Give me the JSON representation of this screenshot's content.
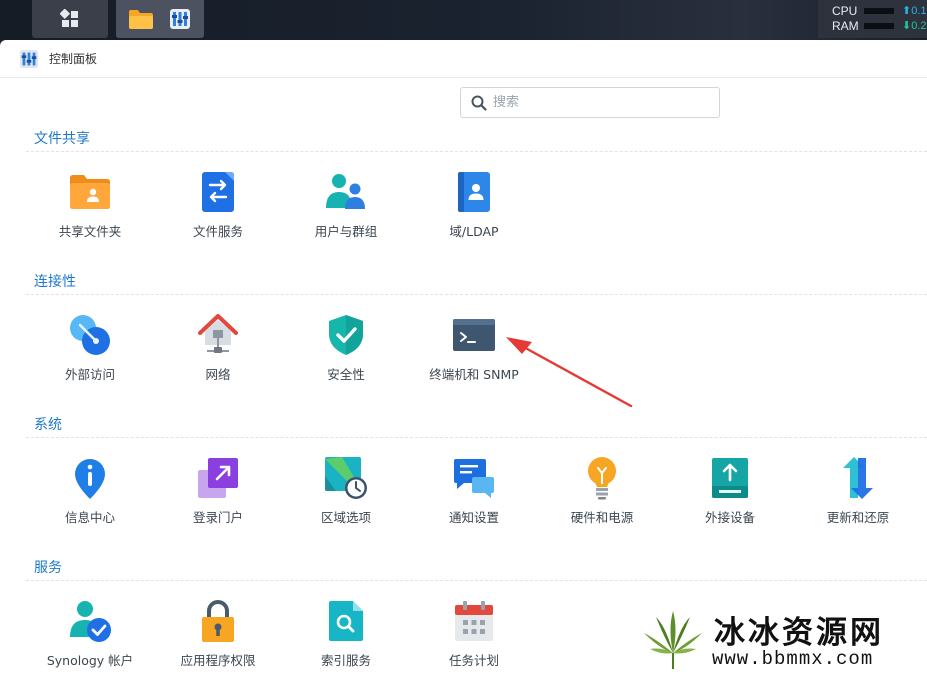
{
  "window": {
    "title": "控制面板"
  },
  "search": {
    "placeholder": "搜索"
  },
  "system_monitor": {
    "cpu_label": "CPU",
    "ram_label": "RAM",
    "cpu_value": "0.1",
    "ram_value": "0.2"
  },
  "sections": [
    {
      "title": "文件共享",
      "items": [
        "共享文件夹",
        "文件服务",
        "用户与群组",
        "域/LDAP"
      ]
    },
    {
      "title": "连接性",
      "items": [
        "外部访问",
        "网络",
        "安全性",
        "终端机和 SNMP"
      ]
    },
    {
      "title": "系统",
      "items": [
        "信息中心",
        "登录门户",
        "区域选项",
        "通知设置",
        "硬件和电源",
        "外接设备",
        "更新和还原"
      ]
    },
    {
      "title": "服务",
      "items": [
        "Synology 帐户",
        "应用程序权限",
        "索引服务",
        "任务计划"
      ]
    }
  ],
  "watermark": {
    "title": "冰冰资源网",
    "url": "www.bbmmx.com"
  },
  "colors": {
    "accent": "#1f79c9",
    "annotation_arrow": "#e53935"
  }
}
